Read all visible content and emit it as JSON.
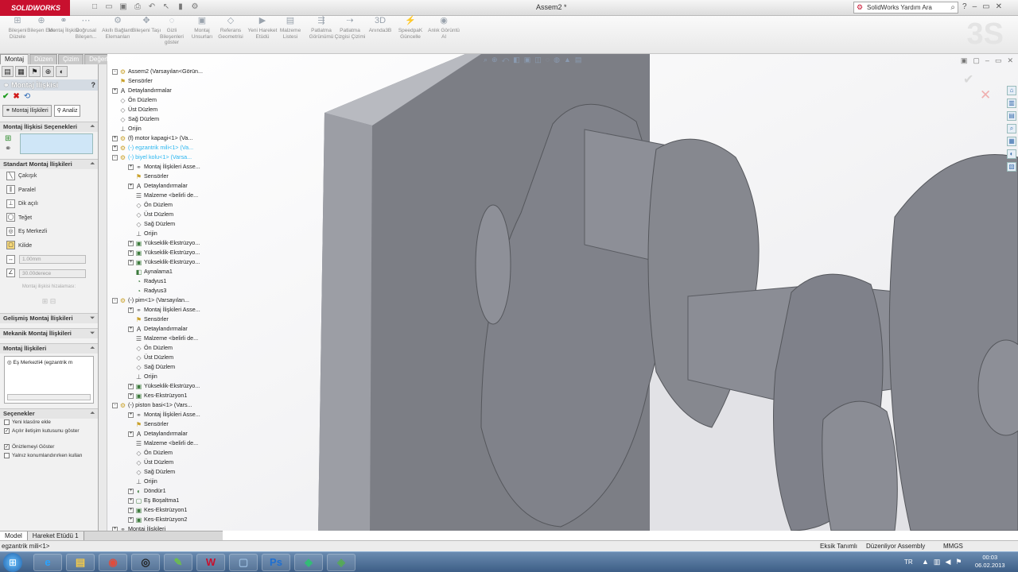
{
  "app": {
    "brand": "SOLIDWORKS",
    "doc_title": "Assem2 *",
    "help_search_placeholder": "SolidWorks Yardım Ara",
    "window_controls": [
      "?",
      "–",
      "▭",
      "✕"
    ]
  },
  "commands": [
    {
      "label": "Bileşeni Düzele",
      "icon": "insert-component-icon"
    },
    {
      "label": "Bileşen Ekle",
      "icon": "add-component-icon"
    },
    {
      "label": "Montaj İlişkisi",
      "icon": "mate-icon"
    },
    {
      "label": "Doğrusal Bileşen...",
      "icon": "linear-pattern-icon"
    },
    {
      "label": "Akıllı Bağlantı Elemanları",
      "icon": "smart-fasteners-icon"
    },
    {
      "label": "Bileşeni Taşı",
      "icon": "move-component-icon"
    },
    {
      "label": "Gizli Bileşenleri göster",
      "icon": "show-hidden-icon"
    },
    {
      "label": "Montaj Unsurları",
      "icon": "assembly-features-icon"
    },
    {
      "label": "Referans Geometrisi",
      "icon": "reference-geometry-icon"
    },
    {
      "label": "Yeni Hareket Etüdü",
      "icon": "motion-study-icon"
    },
    {
      "label": "Malzeme Listesi",
      "icon": "bom-icon"
    },
    {
      "label": "Patlatma Görünümü",
      "icon": "exploded-view-icon"
    },
    {
      "label": "Patlatma Çizgisi Çizimi",
      "icon": "explode-line-icon"
    },
    {
      "label": "Anında3B",
      "icon": "instant3d-icon"
    },
    {
      "label": "SpeedpaK Güncelle",
      "icon": "speedpak-icon"
    },
    {
      "label": "Anlık Görüntü Al",
      "icon": "snapshot-icon"
    }
  ],
  "tabs": [
    "Montaj",
    "Düzen",
    "Çizim",
    "Değerlendir",
    "Ofis Ürünleri"
  ],
  "active_tab": "Montaj",
  "property_manager": {
    "title": "Montaj İlişkisi",
    "subtab_mates": "Montaj İlişkileri",
    "subtab_analysis": "Analiz",
    "group_selections": "Montaj İlişkisi Seçenekleri",
    "group_standard": "Standart Montaj İlişkileri",
    "mate_types": [
      "Çakışık",
      "Paralel",
      "Dik açılı",
      "Teğet",
      "Eş Merkezli",
      "Kilide"
    ],
    "distance_value": "1.00mm",
    "angle_value": "30.00derece",
    "mate_alignment": "Montaj ilişkisi hizalaması:",
    "group_advanced": "Gelişmiş Montaj İlişkileri",
    "group_mechanical": "Mekanik Montaj İlişkileri",
    "group_mates": "Montaj İlişkileri",
    "mates_list_item": "Eş Merkezli4 (egzantrik m",
    "group_options": "Seçenekler",
    "options": [
      {
        "label": "Yeni klasöre ekle",
        "checked": false
      },
      {
        "label": "Açılır iletişim kutusunu göster",
        "checked": true
      },
      {
        "label": "Önizlemeyi Göster",
        "checked": true
      },
      {
        "label": "Yalnız konumlandırırken kullan",
        "checked": false
      }
    ]
  },
  "tree": [
    {
      "label": "Assem2 (Varsayılan<Görün...",
      "level": 0,
      "icon": "assembly-icon",
      "exp": "-"
    },
    {
      "label": "Sensörler",
      "level": 1,
      "icon": "sensor-icon"
    },
    {
      "label": "Detaylandırmalar",
      "level": 1,
      "icon": "annotation-icon",
      "exp": "+"
    },
    {
      "label": "Ön Düzlem",
      "level": 1,
      "icon": "plane-icon"
    },
    {
      "label": "Üst Düzlem",
      "level": 1,
      "icon": "plane-icon"
    },
    {
      "label": "Sağ Düzlem",
      "level": 1,
      "icon": "plane-icon"
    },
    {
      "label": "Orijin",
      "level": 1,
      "icon": "origin-icon"
    },
    {
      "label": "(f) motor kapagi<1> (Va...",
      "level": 1,
      "icon": "part-icon",
      "exp": "+"
    },
    {
      "label": "(-) egzantrik mili<1> (Va...",
      "level": 1,
      "icon": "part-icon",
      "exp": "+",
      "hl": true
    },
    {
      "label": "(-) biyel kolu<1> (Varsa...",
      "level": 1,
      "icon": "part-icon",
      "exp": "-",
      "hl": true
    },
    {
      "label": "Montaj İlişkileri Asse...",
      "level": 2,
      "icon": "mates-folder-icon",
      "exp": "+"
    },
    {
      "label": "Sensörler",
      "level": 2,
      "icon": "sensor-icon"
    },
    {
      "label": "Detaylandırmalar",
      "level": 2,
      "icon": "annotation-icon",
      "exp": "+"
    },
    {
      "label": "Malzeme <belirli de...",
      "level": 2,
      "icon": "material-icon"
    },
    {
      "label": "Ön Düzlem",
      "level": 2,
      "icon": "plane-icon"
    },
    {
      "label": "Üst Düzlem",
      "level": 2,
      "icon": "plane-icon"
    },
    {
      "label": "Sağ Düzlem",
      "level": 2,
      "icon": "plane-icon"
    },
    {
      "label": "Orijin",
      "level": 2,
      "icon": "origin-icon"
    },
    {
      "label": "Yükseklik-Ekstrüzyo...",
      "level": 2,
      "icon": "extrude-icon",
      "exp": "+"
    },
    {
      "label": "Yükseklik-Ekstrüzyo...",
      "level": 2,
      "icon": "extrude-icon",
      "exp": "+"
    },
    {
      "label": "Yükseklik-Ekstrüzyo...",
      "level": 2,
      "icon": "extrude-icon",
      "exp": "+"
    },
    {
      "label": "Aynalama1",
      "level": 2,
      "icon": "mirror-icon"
    },
    {
      "label": "Radyus1",
      "level": 2,
      "icon": "fillet-icon"
    },
    {
      "label": "Radyus3",
      "level": 2,
      "icon": "fillet-icon"
    },
    {
      "label": "(-) pim<1> (Varsayılan...",
      "level": 1,
      "icon": "part-icon",
      "exp": "-"
    },
    {
      "label": "Montaj İlişkileri Asse...",
      "level": 2,
      "icon": "mates-folder-icon",
      "exp": "+"
    },
    {
      "label": "Sensörler",
      "level": 2,
      "icon": "sensor-icon"
    },
    {
      "label": "Detaylandırmalar",
      "level": 2,
      "icon": "annotation-icon",
      "exp": "+"
    },
    {
      "label": "Malzeme <belirli de...",
      "level": 2,
      "icon": "material-icon"
    },
    {
      "label": "Ön Düzlem",
      "level": 2,
      "icon": "plane-icon"
    },
    {
      "label": "Üst Düzlem",
      "level": 2,
      "icon": "plane-icon"
    },
    {
      "label": "Sağ Düzlem",
      "level": 2,
      "icon": "plane-icon"
    },
    {
      "label": "Orijin",
      "level": 2,
      "icon": "origin-icon"
    },
    {
      "label": "Yükseklik-Ekstrüzyo...",
      "level": 2,
      "icon": "extrude-icon",
      "exp": "+"
    },
    {
      "label": "Kes-Ekstrüzyon1",
      "level": 2,
      "icon": "cut-extrude-icon",
      "exp": "+"
    },
    {
      "label": "(-) piston basi<1> (Vars...",
      "level": 1,
      "icon": "part-icon",
      "exp": "-"
    },
    {
      "label": "Montaj İlişkileri Asse...",
      "level": 2,
      "icon": "mates-folder-icon",
      "exp": "+"
    },
    {
      "label": "Sensörler",
      "level": 2,
      "icon": "sensor-icon"
    },
    {
      "label": "Detaylandırmalar",
      "level": 2,
      "icon": "annotation-icon",
      "exp": "+"
    },
    {
      "label": "Malzeme <belirli de...",
      "level": 2,
      "icon": "material-icon"
    },
    {
      "label": "Ön Düzlem",
      "level": 2,
      "icon": "plane-icon"
    },
    {
      "label": "Üst Düzlem",
      "level": 2,
      "icon": "plane-icon"
    },
    {
      "label": "Sağ Düzlem",
      "level": 2,
      "icon": "plane-icon"
    },
    {
      "label": "Orijin",
      "level": 2,
      "icon": "origin-icon"
    },
    {
      "label": "Döndür1",
      "level": 2,
      "icon": "revolve-icon",
      "exp": "+"
    },
    {
      "label": "Eş Boşaltma1",
      "level": 2,
      "icon": "shell-icon",
      "exp": "+"
    },
    {
      "label": "Kes-Ekstrüzyon1",
      "level": 2,
      "icon": "cut-extrude-icon",
      "exp": "+"
    },
    {
      "label": "Kes-Ekstrüzyon2",
      "level": 2,
      "icon": "cut-extrude-icon",
      "exp": "+"
    },
    {
      "label": "Montaj İlişkileri",
      "level": 1,
      "icon": "mates-folder-icon",
      "exp": "+"
    }
  ],
  "bottom_tabs": [
    "Model",
    "Hareket Etüdü 1"
  ],
  "status": {
    "selection": "egzantrik mili<1>",
    "under_defined": "Eksik Tanımlı",
    "editing": "Düzenliyor Assembly",
    "units": "MMGS"
  },
  "taskbar": {
    "apps": [
      "ie-icon",
      "explorer-icon",
      "chrome-icon",
      "steam-icon",
      "paint-icon",
      "solidworks-icon",
      "notepad-icon",
      "photoshop-icon",
      "app-icon",
      "app2-icon"
    ],
    "lang": "TR",
    "time": "00:03",
    "date": "06.02.2013"
  },
  "colors": {
    "brand": "#c8102e",
    "highlight": "#29b6f0",
    "part_face": "#7f8189",
    "part_face_light": "#9a9ca4"
  }
}
